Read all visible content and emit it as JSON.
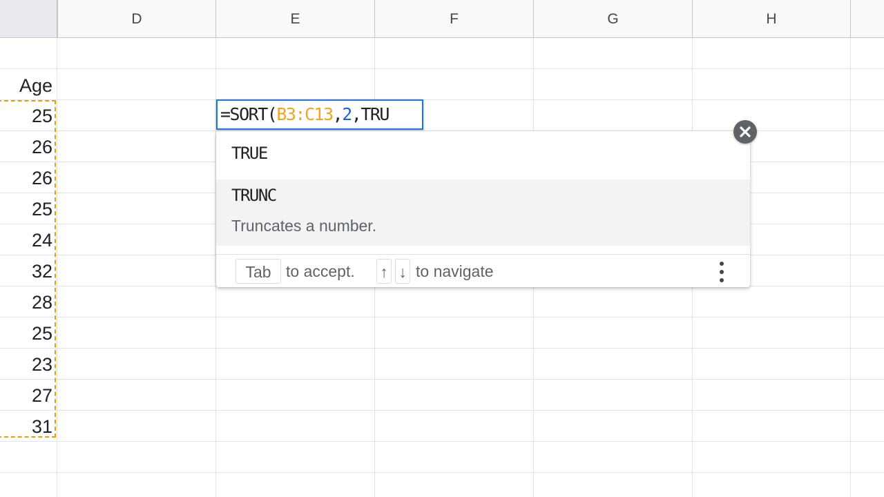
{
  "columns": [
    "D",
    "E",
    "F",
    "G",
    "H"
  ],
  "age_header": "Age",
  "ages": [
    "25",
    "26",
    "26",
    "25",
    "24",
    "32",
    "28",
    "25",
    "23",
    "27",
    "31"
  ],
  "formula": {
    "prefix": "=SORT(",
    "range": "B3:C13",
    "sep1": ",",
    "sort_column": "2",
    "sep2": ",",
    "partial": "TRU"
  },
  "autocomplete": {
    "items": [
      {
        "name": "TRUE",
        "description": ""
      },
      {
        "name": "TRUNC",
        "description": "Truncates a number."
      }
    ],
    "footer": {
      "tab_key": "Tab",
      "accept_text": "to accept.",
      "up_key": "↑",
      "down_key": "↓",
      "navigate_text": "to navigate"
    }
  },
  "colors": {
    "selection_border": "#1a73e8",
    "range_reference": "#f4a51c",
    "number_literal": "#1967d2",
    "copy_marquee": "#f29900"
  },
  "icons": {
    "close": "close-circle-icon",
    "more": "more-vert-icon"
  }
}
